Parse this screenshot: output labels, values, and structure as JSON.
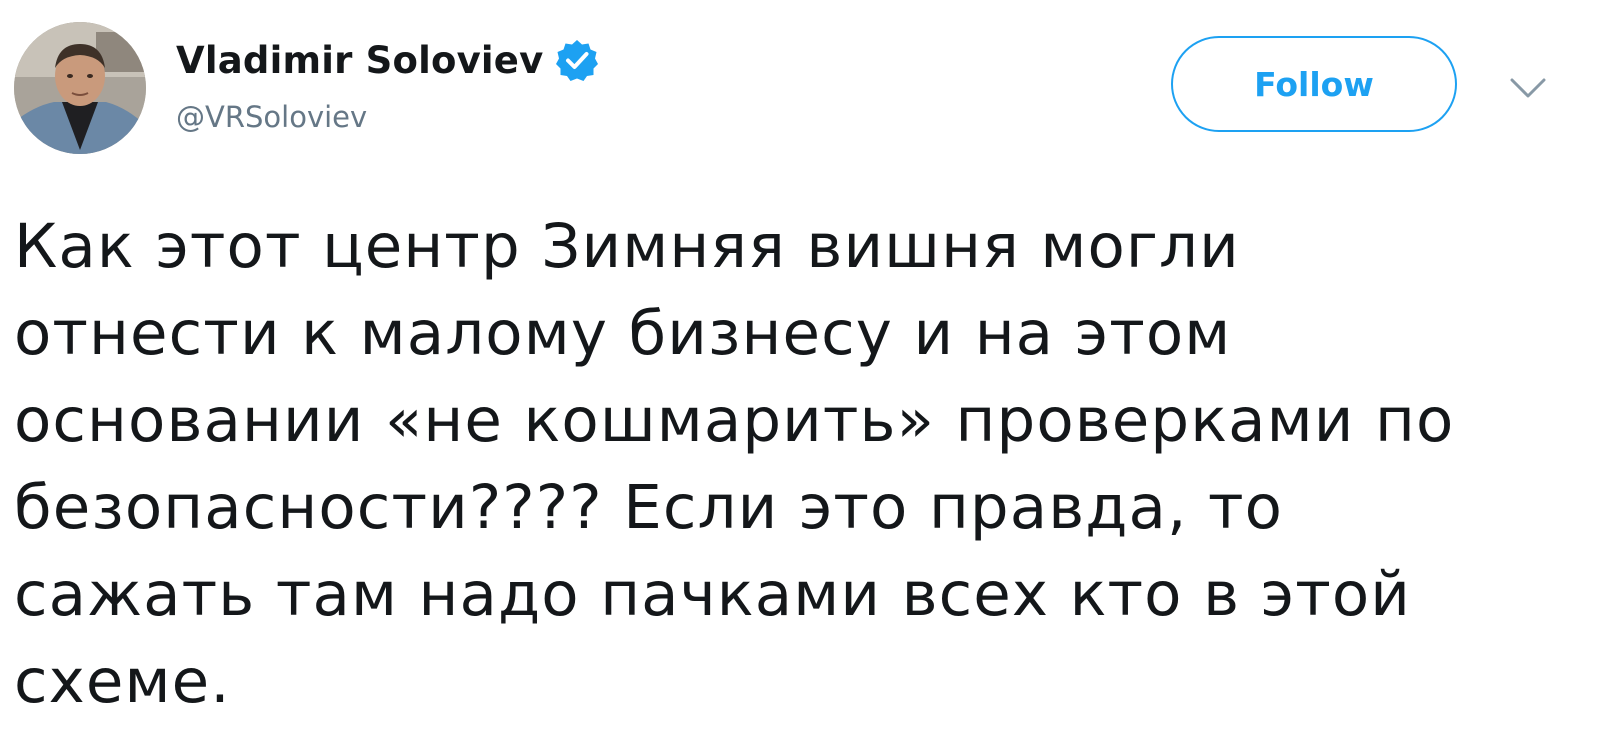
{
  "user": {
    "display_name": "Vladimir Soloviev",
    "handle": "@VRSoloviev",
    "verified": true,
    "avatar_icon": "user-avatar-photo"
  },
  "actions": {
    "follow_label": "Follow",
    "menu_icon": "chevron-down-icon"
  },
  "tweet": {
    "lines": [
      "Как этот центр Зимняя вишня могли",
      "отнести к малому бизнесу и на этом",
      "основании «не кошмарить» проверками по",
      "безопасности???? Если это правда, то",
      "сажать там надо пачками всех кто в этой",
      "схеме."
    ]
  },
  "colors": {
    "accent": "#1da1f2",
    "text": "#14171a",
    "secondary_text": "#657786",
    "background": "#ffffff"
  }
}
